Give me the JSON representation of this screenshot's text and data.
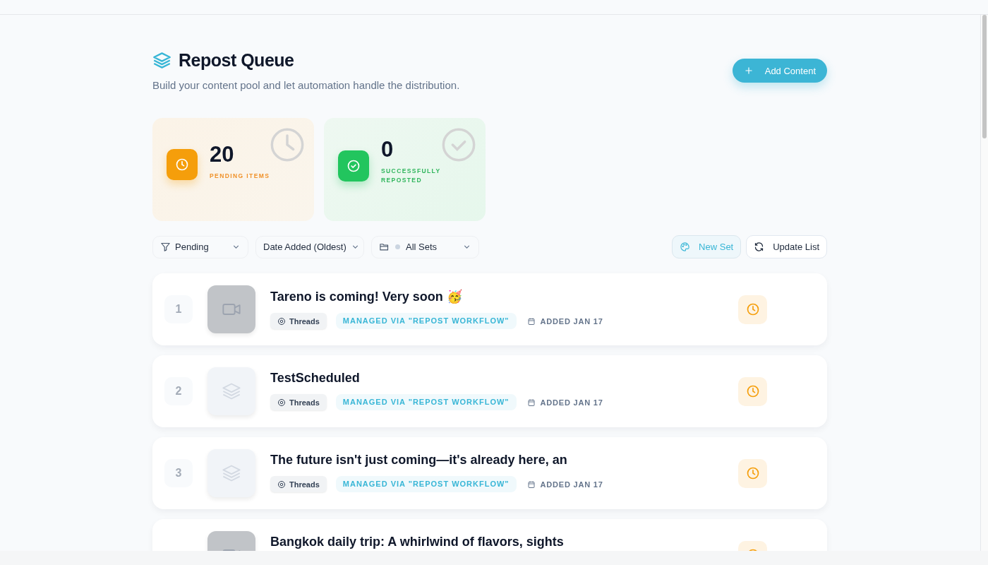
{
  "header": {
    "title": "Repost Queue",
    "subtitle": "Build your content pool and let automation handle the distribution.",
    "add_button": "Add Content"
  },
  "stats": [
    {
      "kind": "pending",
      "value": "20",
      "label": "PENDING ITEMS"
    },
    {
      "kind": "success",
      "value": "0",
      "label": "SUCCESSFULLY REPOSTED"
    }
  ],
  "filters": {
    "status": "Pending",
    "sort": "Date Added (Oldest)",
    "set": "All Sets",
    "new_set": "New Set",
    "update": "Update List"
  },
  "queue": [
    {
      "number": "1",
      "thumbnail": {
        "kind": "video"
      },
      "title": "Tareno is coming! Very soon 🥳",
      "platform": "Threads",
      "managed": "MANAGED VIA \"REPOST WORKFLOW\"",
      "added": "ADDED JAN 17",
      "status": {
        "kind": "pending"
      }
    },
    {
      "number": "2",
      "thumbnail": {
        "kind": "layers"
      },
      "title": "TestScheduled",
      "platform": "Threads",
      "managed": "MANAGED VIA \"REPOST WORKFLOW\"",
      "added": "ADDED JAN 17",
      "status": {
        "kind": "pending"
      }
    },
    {
      "number": "3",
      "thumbnail": {
        "kind": "layers"
      },
      "title": "The future isn't just coming—it's already here, an",
      "platform": "Threads",
      "managed": "MANAGED VIA \"REPOST WORKFLOW\"",
      "added": "ADDED JAN 17",
      "status": {
        "kind": "pending"
      }
    },
    {
      "thumbnail": {
        "kind": "video"
      },
      "title": "Bangkok daily trip: A whirlwind of flavors, sights",
      "status": {
        "kind": "pending"
      }
    }
  ]
}
